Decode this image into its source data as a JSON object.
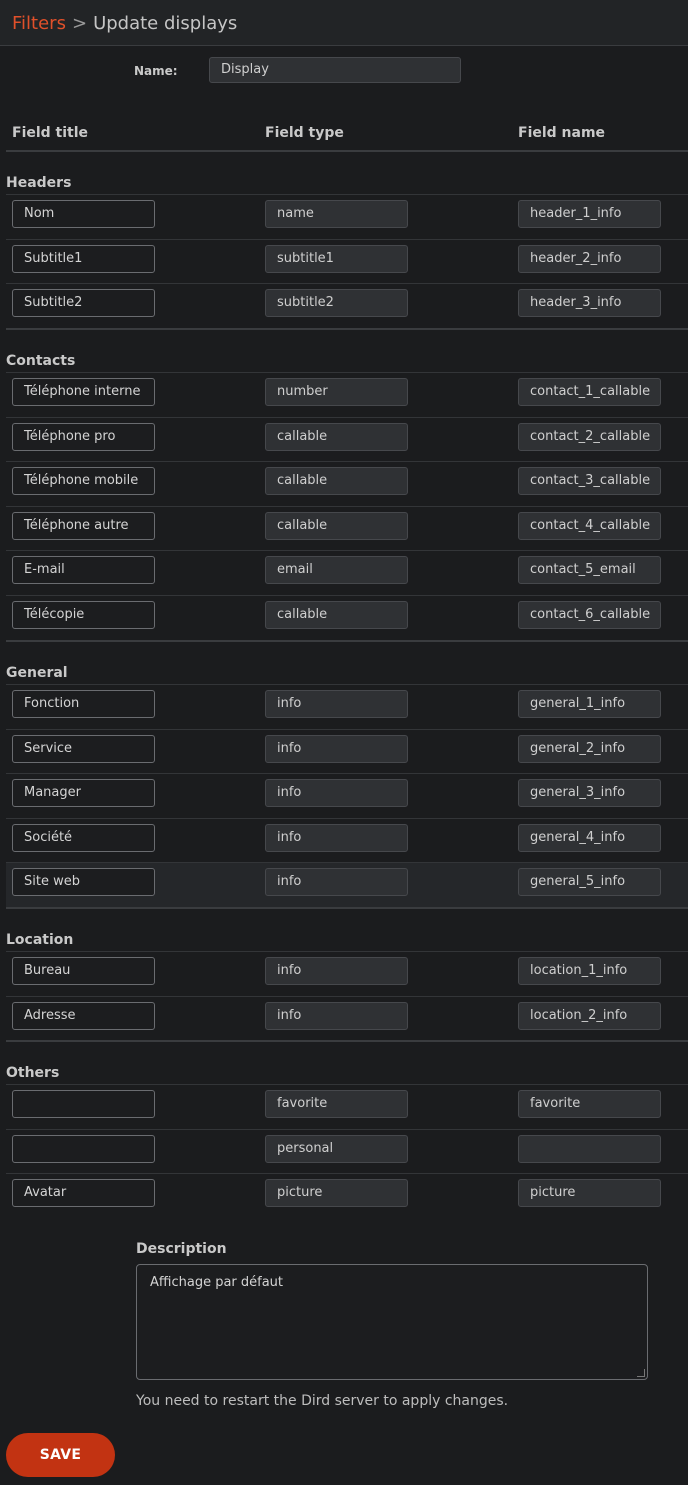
{
  "breadcrumb": {
    "parent": "Filters",
    "separator": ">",
    "current": "Update displays"
  },
  "name_label": "Name:",
  "name_value": "Display",
  "columns": {
    "title": "Field title",
    "type": "Field type",
    "name": "Field name"
  },
  "sections": [
    {
      "title": "Headers",
      "rows": [
        {
          "title": "Nom",
          "type": "name",
          "name": "header_1_info"
        },
        {
          "title": "Subtitle1",
          "type": "subtitle1",
          "name": "header_2_info"
        },
        {
          "title": "Subtitle2",
          "type": "subtitle2",
          "name": "header_3_info"
        }
      ]
    },
    {
      "title": "Contacts",
      "rows": [
        {
          "title": "Téléphone interne",
          "type": "number",
          "name": "contact_1_callable"
        },
        {
          "title": "Téléphone pro",
          "type": "callable",
          "name": "contact_2_callable"
        },
        {
          "title": "Téléphone mobile",
          "type": "callable",
          "name": "contact_3_callable"
        },
        {
          "title": "Téléphone autre",
          "type": "callable",
          "name": "contact_4_callable"
        },
        {
          "title": "E-mail",
          "type": "email",
          "name": "contact_5_email"
        },
        {
          "title": "Télécopie",
          "type": "callable",
          "name": "contact_6_callable"
        }
      ]
    },
    {
      "title": "General",
      "rows": [
        {
          "title": "Fonction",
          "type": "info",
          "name": "general_1_info"
        },
        {
          "title": "Service",
          "type": "info",
          "name": "general_2_info"
        },
        {
          "title": "Manager",
          "type": "info",
          "name": "general_3_info"
        },
        {
          "title": "Société",
          "type": "info",
          "name": "general_4_info"
        },
        {
          "title": "Site web",
          "type": "info",
          "name": "general_5_info"
        }
      ]
    },
    {
      "title": "Location",
      "rows": [
        {
          "title": "Bureau",
          "type": "info",
          "name": "location_1_info"
        },
        {
          "title": "Adresse",
          "type": "info",
          "name": "location_2_info"
        }
      ]
    },
    {
      "title": "Others",
      "rows": [
        {
          "title": "",
          "type": "favorite",
          "name": "favorite"
        },
        {
          "title": "",
          "type": "personal",
          "name": ""
        },
        {
          "title": "Avatar",
          "type": "picture",
          "name": "picture"
        }
      ]
    }
  ],
  "description_label": "Description",
  "description_value": "Affichage par défaut",
  "restart_note": "You need to restart the Dird server to apply changes.",
  "save_label": "SAVE"
}
